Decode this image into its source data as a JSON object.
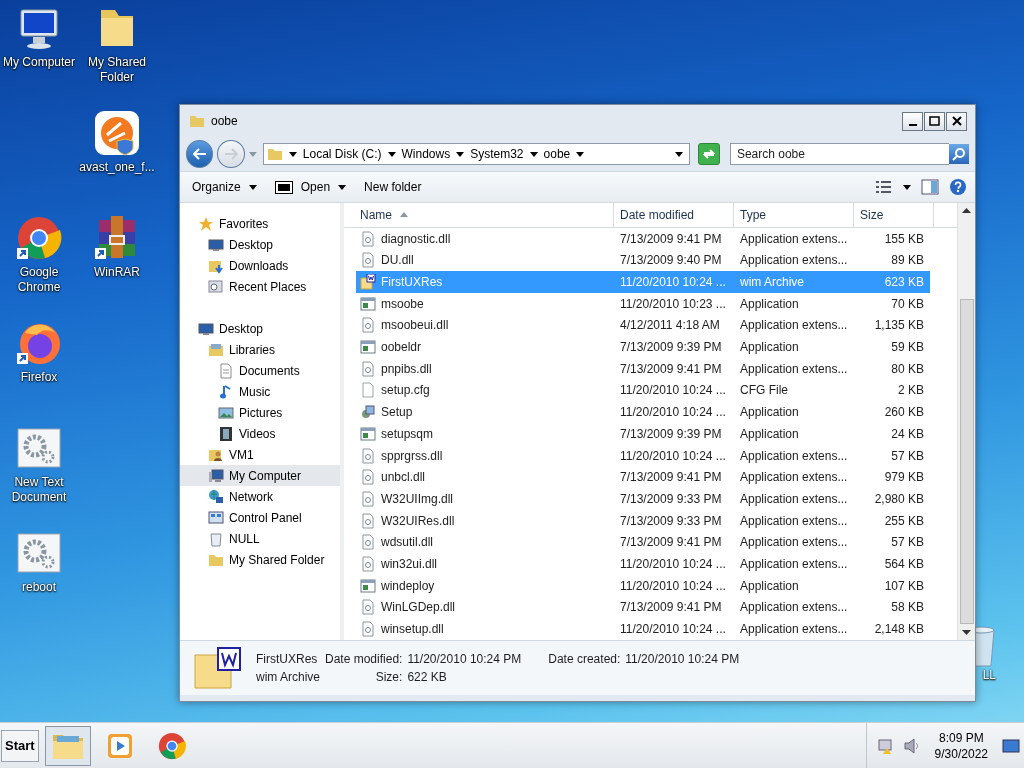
{
  "desktop_icons": [
    {
      "label": "My Computer",
      "kind": "computer"
    },
    {
      "label": "My Shared Folder",
      "kind": "folder"
    },
    {
      "label": "avast_one_f...",
      "kind": "avast"
    },
    {
      "label": "Google Chrome",
      "kind": "chrome"
    },
    {
      "label": "WinRAR",
      "kind": "winrar"
    },
    {
      "label": "Firefox",
      "kind": "firefox"
    },
    {
      "label": "New Text Document",
      "kind": "gears"
    },
    {
      "label": "reboot",
      "kind": "gears"
    },
    {
      "label": "LL",
      "kind": "bin"
    }
  ],
  "window": {
    "title": "oobe",
    "breadcrumb": [
      "Local Disk (C:)",
      "Windows",
      "System32",
      "oobe"
    ],
    "search": {
      "placeholder": "Search oobe"
    },
    "toolbar": [
      {
        "label": "Organize",
        "kind": "menu"
      },
      {
        "label": "Open",
        "kind": "open"
      },
      {
        "label": "New folder",
        "kind": "plain"
      }
    ],
    "nav": [
      {
        "label": "Favorites",
        "kind": "star",
        "selected": false,
        "children": [
          {
            "label": "Desktop",
            "kind": "desktop",
            "selected": false
          },
          {
            "label": "Downloads",
            "kind": "downloads",
            "selected": false
          },
          {
            "label": "Recent Places",
            "kind": "recent",
            "selected": false
          }
        ]
      },
      {
        "label": "Desktop",
        "kind": "desktop",
        "selected": false,
        "children": [
          {
            "label": "Libraries",
            "kind": "libraries",
            "selected": false,
            "children": [
              {
                "label": "Documents",
                "kind": "documents",
                "selected": false
              },
              {
                "label": "Music",
                "kind": "music",
                "selected": false
              },
              {
                "label": "Pictures",
                "kind": "pictures",
                "selected": false
              },
              {
                "label": "Videos",
                "kind": "videos",
                "selected": false
              }
            ]
          },
          {
            "label": "VM1",
            "kind": "user",
            "selected": false
          },
          {
            "label": "My Computer",
            "kind": "computer",
            "selected": true
          },
          {
            "label": "Network",
            "kind": "network",
            "selected": false
          },
          {
            "label": "Control Panel",
            "kind": "control",
            "selected": false
          },
          {
            "label": "NULL",
            "kind": "bin",
            "selected": false
          },
          {
            "label": "My Shared Folder",
            "kind": "folder",
            "selected": false
          }
        ]
      }
    ],
    "table": {
      "columns": [
        "Name",
        "Date modified",
        "Type",
        "Size"
      ],
      "rows": [
        {
          "kind": "dll",
          "name": "diagnostic.dll",
          "date": "7/13/2009 9:41 PM",
          "type": "Application extens...",
          "size": "155 KB",
          "selected": false
        },
        {
          "kind": "dll",
          "name": "DU.dll",
          "date": "7/13/2009 9:40 PM",
          "type": "Application extens...",
          "size": "89 KB",
          "selected": false
        },
        {
          "kind": "wim",
          "name": "FirstUXRes",
          "date": "11/20/2010 10:24 ...",
          "type": "wim Archive",
          "size": "623 KB",
          "selected": true
        },
        {
          "kind": "app",
          "name": "msoobe",
          "date": "11/20/2010 10:23 ...",
          "type": "Application",
          "size": "70 KB",
          "selected": false
        },
        {
          "kind": "dll",
          "name": "msoobeui.dll",
          "date": "4/12/2011 4:18 AM",
          "type": "Application extens...",
          "size": "1,135 KB",
          "selected": false
        },
        {
          "kind": "app",
          "name": "oobeldr",
          "date": "7/13/2009 9:39 PM",
          "type": "Application",
          "size": "59 KB",
          "selected": false
        },
        {
          "kind": "dll",
          "name": "pnpibs.dll",
          "date": "7/13/2009 9:41 PM",
          "type": "Application extens...",
          "size": "80 KB",
          "selected": false
        },
        {
          "kind": "cfg",
          "name": "setup.cfg",
          "date": "11/20/2010 10:24 ...",
          "type": "CFG File",
          "size": "2 KB",
          "selected": false
        },
        {
          "kind": "setup",
          "name": "Setup",
          "date": "11/20/2010 10:24 ...",
          "type": "Application",
          "size": "260 KB",
          "selected": false
        },
        {
          "kind": "app",
          "name": "setupsqm",
          "date": "7/13/2009 9:39 PM",
          "type": "Application",
          "size": "24 KB",
          "selected": false
        },
        {
          "kind": "dll",
          "name": "spprgrss.dll",
          "date": "11/20/2010 10:24 ...",
          "type": "Application extens...",
          "size": "57 KB",
          "selected": false
        },
        {
          "kind": "dll",
          "name": "unbcl.dll",
          "date": "7/13/2009 9:41 PM",
          "type": "Application extens...",
          "size": "979 KB",
          "selected": false
        },
        {
          "kind": "dll",
          "name": "W32UIImg.dll",
          "date": "7/13/2009 9:33 PM",
          "type": "Application extens...",
          "size": "2,980 KB",
          "selected": false
        },
        {
          "kind": "dll",
          "name": "W32UIRes.dll",
          "date": "7/13/2009 9:33 PM",
          "type": "Application extens...",
          "size": "255 KB",
          "selected": false
        },
        {
          "kind": "dll",
          "name": "wdsutil.dll",
          "date": "7/13/2009 9:41 PM",
          "type": "Application extens...",
          "size": "57 KB",
          "selected": false
        },
        {
          "kind": "dll",
          "name": "win32ui.dll",
          "date": "11/20/2010 10:24 ...",
          "type": "Application extens...",
          "size": "564 KB",
          "selected": false
        },
        {
          "kind": "app",
          "name": "windeploy",
          "date": "11/20/2010 10:24 ...",
          "type": "Application",
          "size": "107 KB",
          "selected": false
        },
        {
          "kind": "dll",
          "name": "WinLGDep.dll",
          "date": "7/13/2009 9:41 PM",
          "type": "Application extens...",
          "size": "58 KB",
          "selected": false
        },
        {
          "kind": "dll",
          "name": "winsetup.dll",
          "date": "11/20/2010 10:24 ...",
          "type": "Application extens...",
          "size": "2,148 KB",
          "selected": false
        }
      ]
    },
    "details": {
      "name": "FirstUXRes",
      "type": "wim Archive",
      "fields": [
        {
          "label": "Date modified:",
          "value": "11/20/2010 10:24 PM"
        },
        {
          "label": "Size:",
          "value": "622 KB"
        },
        {
          "label": "Date created:",
          "value": "11/20/2010 10:24 PM"
        }
      ]
    }
  },
  "taskbar": {
    "start": "Start",
    "apps": [
      {
        "kind": "explorer",
        "selected": true
      },
      {
        "kind": "media",
        "selected": false
      },
      {
        "kind": "chrome",
        "selected": false
      }
    ],
    "time": "8:09 PM",
    "date": "9/30/2022"
  }
}
